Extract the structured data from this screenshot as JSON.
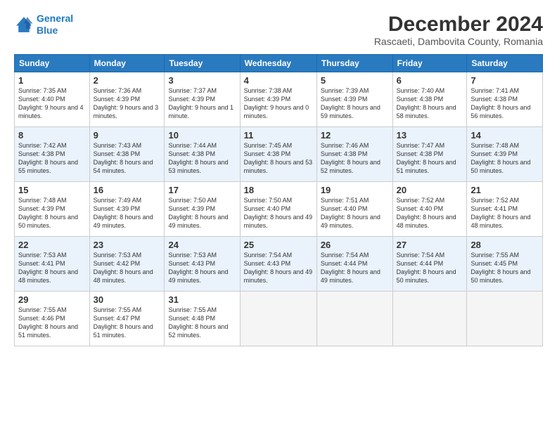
{
  "logo": {
    "line1": "General",
    "line2": "Blue"
  },
  "title": "December 2024",
  "subtitle": "Rascaeti, Dambovita County, Romania",
  "days_of_week": [
    "Sunday",
    "Monday",
    "Tuesday",
    "Wednesday",
    "Thursday",
    "Friday",
    "Saturday"
  ],
  "weeks": [
    [
      {
        "day": 1,
        "sunrise": "7:35 AM",
        "sunset": "4:40 PM",
        "daylight": "9 hours and 4 minutes."
      },
      {
        "day": 2,
        "sunrise": "7:36 AM",
        "sunset": "4:39 PM",
        "daylight": "9 hours and 3 minutes."
      },
      {
        "day": 3,
        "sunrise": "7:37 AM",
        "sunset": "4:39 PM",
        "daylight": "9 hours and 1 minute."
      },
      {
        "day": 4,
        "sunrise": "7:38 AM",
        "sunset": "4:39 PM",
        "daylight": "9 hours and 0 minutes."
      },
      {
        "day": 5,
        "sunrise": "7:39 AM",
        "sunset": "4:39 PM",
        "daylight": "8 hours and 59 minutes."
      },
      {
        "day": 6,
        "sunrise": "7:40 AM",
        "sunset": "4:38 PM",
        "daylight": "8 hours and 58 minutes."
      },
      {
        "day": 7,
        "sunrise": "7:41 AM",
        "sunset": "4:38 PM",
        "daylight": "8 hours and 56 minutes."
      }
    ],
    [
      {
        "day": 8,
        "sunrise": "7:42 AM",
        "sunset": "4:38 PM",
        "daylight": "8 hours and 55 minutes."
      },
      {
        "day": 9,
        "sunrise": "7:43 AM",
        "sunset": "4:38 PM",
        "daylight": "8 hours and 54 minutes."
      },
      {
        "day": 10,
        "sunrise": "7:44 AM",
        "sunset": "4:38 PM",
        "daylight": "8 hours and 53 minutes."
      },
      {
        "day": 11,
        "sunrise": "7:45 AM",
        "sunset": "4:38 PM",
        "daylight": "8 hours and 53 minutes."
      },
      {
        "day": 12,
        "sunrise": "7:46 AM",
        "sunset": "4:38 PM",
        "daylight": "8 hours and 52 minutes."
      },
      {
        "day": 13,
        "sunrise": "7:47 AM",
        "sunset": "4:38 PM",
        "daylight": "8 hours and 51 minutes."
      },
      {
        "day": 14,
        "sunrise": "7:48 AM",
        "sunset": "4:39 PM",
        "daylight": "8 hours and 50 minutes."
      }
    ],
    [
      {
        "day": 15,
        "sunrise": "7:48 AM",
        "sunset": "4:39 PM",
        "daylight": "8 hours and 50 minutes."
      },
      {
        "day": 16,
        "sunrise": "7:49 AM",
        "sunset": "4:39 PM",
        "daylight": "8 hours and 49 minutes."
      },
      {
        "day": 17,
        "sunrise": "7:50 AM",
        "sunset": "4:39 PM",
        "daylight": "8 hours and 49 minutes."
      },
      {
        "day": 18,
        "sunrise": "7:50 AM",
        "sunset": "4:40 PM",
        "daylight": "8 hours and 49 minutes."
      },
      {
        "day": 19,
        "sunrise": "7:51 AM",
        "sunset": "4:40 PM",
        "daylight": "8 hours and 49 minutes."
      },
      {
        "day": 20,
        "sunrise": "7:52 AM",
        "sunset": "4:40 PM",
        "daylight": "8 hours and 48 minutes."
      },
      {
        "day": 21,
        "sunrise": "7:52 AM",
        "sunset": "4:41 PM",
        "daylight": "8 hours and 48 minutes."
      }
    ],
    [
      {
        "day": 22,
        "sunrise": "7:53 AM",
        "sunset": "4:41 PM",
        "daylight": "8 hours and 48 minutes."
      },
      {
        "day": 23,
        "sunrise": "7:53 AM",
        "sunset": "4:42 PM",
        "daylight": "8 hours and 48 minutes."
      },
      {
        "day": 24,
        "sunrise": "7:53 AM",
        "sunset": "4:43 PM",
        "daylight": "8 hours and 49 minutes."
      },
      {
        "day": 25,
        "sunrise": "7:54 AM",
        "sunset": "4:43 PM",
        "daylight": "8 hours and 49 minutes."
      },
      {
        "day": 26,
        "sunrise": "7:54 AM",
        "sunset": "4:44 PM",
        "daylight": "8 hours and 49 minutes."
      },
      {
        "day": 27,
        "sunrise": "7:54 AM",
        "sunset": "4:44 PM",
        "daylight": "8 hours and 50 minutes."
      },
      {
        "day": 28,
        "sunrise": "7:55 AM",
        "sunset": "4:45 PM",
        "daylight": "8 hours and 50 minutes."
      }
    ],
    [
      {
        "day": 29,
        "sunrise": "7:55 AM",
        "sunset": "4:46 PM",
        "daylight": "8 hours and 51 minutes."
      },
      {
        "day": 30,
        "sunrise": "7:55 AM",
        "sunset": "4:47 PM",
        "daylight": "8 hours and 51 minutes."
      },
      {
        "day": 31,
        "sunrise": "7:55 AM",
        "sunset": "4:48 PM",
        "daylight": "8 hours and 52 minutes."
      },
      null,
      null,
      null,
      null
    ]
  ]
}
